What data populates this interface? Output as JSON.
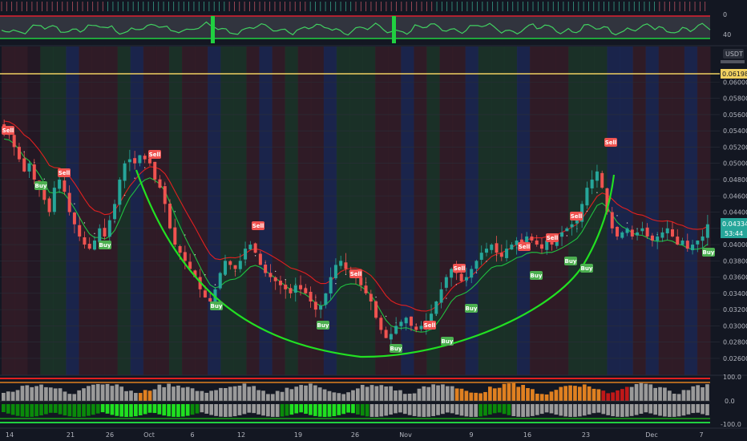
{
  "header": {
    "currency": "USDT"
  },
  "price_axis": {
    "ticks": [
      "0.06000",
      "0.05800",
      "0.05600",
      "0.05400",
      "0.05200",
      "0.05000",
      "0.04800",
      "0.04600",
      "0.04400",
      "0.04200",
      "0.04000",
      "0.03800",
      "0.03600",
      "0.03400",
      "0.03200",
      "0.03000",
      "0.02800",
      "0.02600"
    ],
    "h_line_label": "0.06198",
    "last_price_label": "0.04334",
    "countdown_label": "53:44"
  },
  "x_axis": {
    "labels": [
      "14",
      "21",
      "26",
      "Oct",
      "6",
      "12",
      "19",
      "26",
      "Nov",
      "9",
      "16",
      "23",
      "Dec",
      "7"
    ]
  },
  "top_oscillator": {
    "axis_labels": [
      "0",
      "40"
    ]
  },
  "bottom_oscillator": {
    "axis_labels": [
      "100.0",
      "0.0",
      "-100.0"
    ]
  },
  "signals": {
    "buy_text": "Buy",
    "sell_text": "Sell"
  },
  "colors": {
    "background": "#131722",
    "up": "#26a69a",
    "down": "#ef5350",
    "buy_tag": "#4caf50",
    "sell_tag": "#f05350",
    "curve": "#00e000",
    "h_line": "#f0d060",
    "ema_red": "#e02020",
    "ema_green": "#20c040",
    "orange_bar": "#e08020",
    "gray_bar": "#9a9a9a"
  },
  "chart_data": {
    "type": "candlestick",
    "price_range": [
      0.0255,
      0.0628
    ],
    "horizontal_line": 0.06198,
    "last_price": 0.04334,
    "x_labels": [
      "14",
      "21",
      "26",
      "Oct",
      "6",
      "12",
      "19",
      "26",
      "Nov",
      "9",
      "16",
      "23",
      "Dec",
      "7"
    ],
    "close_path": [
      0.054,
      0.0535,
      0.052,
      0.0505,
      0.049,
      0.05,
      0.048,
      0.047,
      0.0455,
      0.044,
      0.047,
      0.048,
      0.0465,
      0.044,
      0.0425,
      0.041,
      0.04,
      0.0395,
      0.0405,
      0.042,
      0.041,
      0.043,
      0.045,
      0.048,
      0.05,
      0.0505,
      0.05,
      0.051,
      0.0505,
      0.05,
      0.048,
      0.047,
      0.045,
      0.042,
      0.04,
      0.039,
      0.038,
      0.037,
      0.036,
      0.0345,
      0.0335,
      0.033,
      0.0345,
      0.0365,
      0.038,
      0.0375,
      0.037,
      0.038,
      0.0395,
      0.04,
      0.039,
      0.0375,
      0.0365,
      0.036,
      0.0355,
      0.035,
      0.0345,
      0.034,
      0.035,
      0.0345,
      0.034,
      0.033,
      0.032,
      0.0325,
      0.034,
      0.036,
      0.0375,
      0.038,
      0.037,
      0.0365,
      0.036,
      0.035,
      0.034,
      0.033,
      0.031,
      0.0295,
      0.0285,
      0.029,
      0.03,
      0.0305,
      0.031,
      0.03,
      0.0295,
      0.03,
      0.0305,
      0.0315,
      0.033,
      0.0345,
      0.036,
      0.037,
      0.0365,
      0.0355,
      0.036,
      0.037,
      0.038,
      0.039,
      0.0395,
      0.04,
      0.039,
      0.0385,
      0.0395,
      0.04,
      0.0405,
      0.04,
      0.041,
      0.0405,
      0.04,
      0.0395,
      0.0405,
      0.04,
      0.041,
      0.0415,
      0.042,
      0.0425,
      0.043,
      0.045,
      0.047,
      0.048,
      0.049,
      0.047,
      0.044,
      0.042,
      0.041,
      0.0415,
      0.042,
      0.041,
      0.0415,
      0.042,
      0.041,
      0.0405,
      0.041,
      0.0415,
      0.042,
      0.041,
      0.04,
      0.0405,
      0.0395,
      0.04,
      0.0405,
      0.041,
      0.0425
    ],
    "buy_signals": 10,
    "sell_signals": 11
  }
}
